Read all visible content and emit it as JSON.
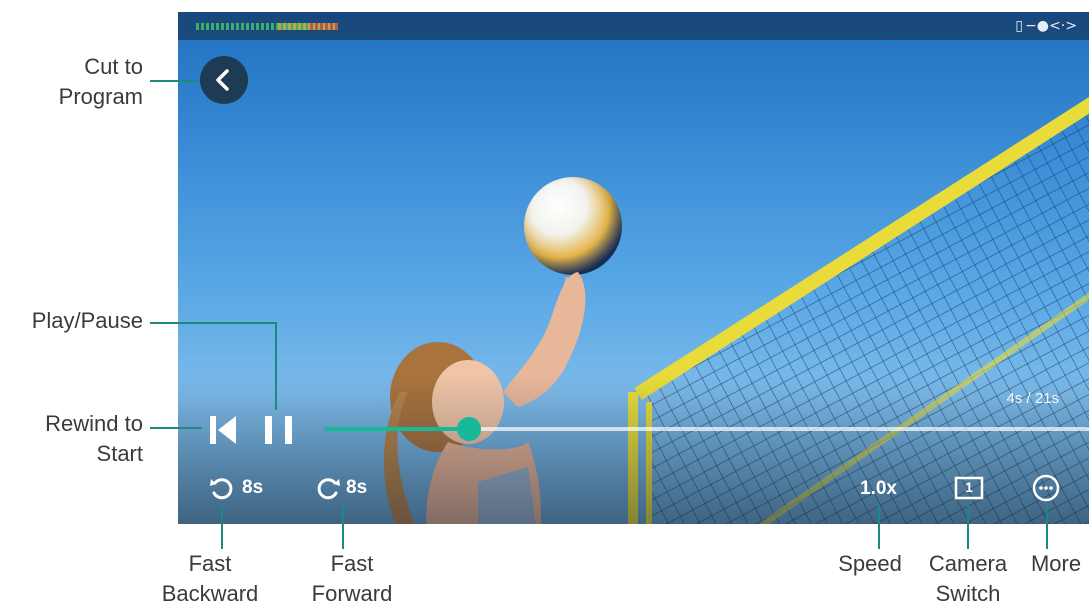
{
  "player": {
    "timecode": "4s / 21s",
    "progress_fraction": 0.19,
    "speed_label": "1.0x",
    "rewind_label": "8s",
    "forward_label": "8s",
    "camera_number": "1",
    "status_icons": [
      "sd-card-icon",
      "power-plug-icon",
      "code-arrows-icon"
    ],
    "accent_color": "#18b89a"
  },
  "callouts": {
    "cut_to_program": [
      "Cut to",
      "Program"
    ],
    "play_pause": [
      "Play/Pause"
    ],
    "rewind_to_start": [
      "Rewind to",
      "Start"
    ],
    "fast_backward": [
      "Fast",
      "Backward"
    ],
    "fast_forward": [
      "Fast",
      "Forward"
    ],
    "speed": [
      "Speed"
    ],
    "camera_switch": [
      "Camera",
      "Switch"
    ],
    "more": [
      "More"
    ]
  }
}
